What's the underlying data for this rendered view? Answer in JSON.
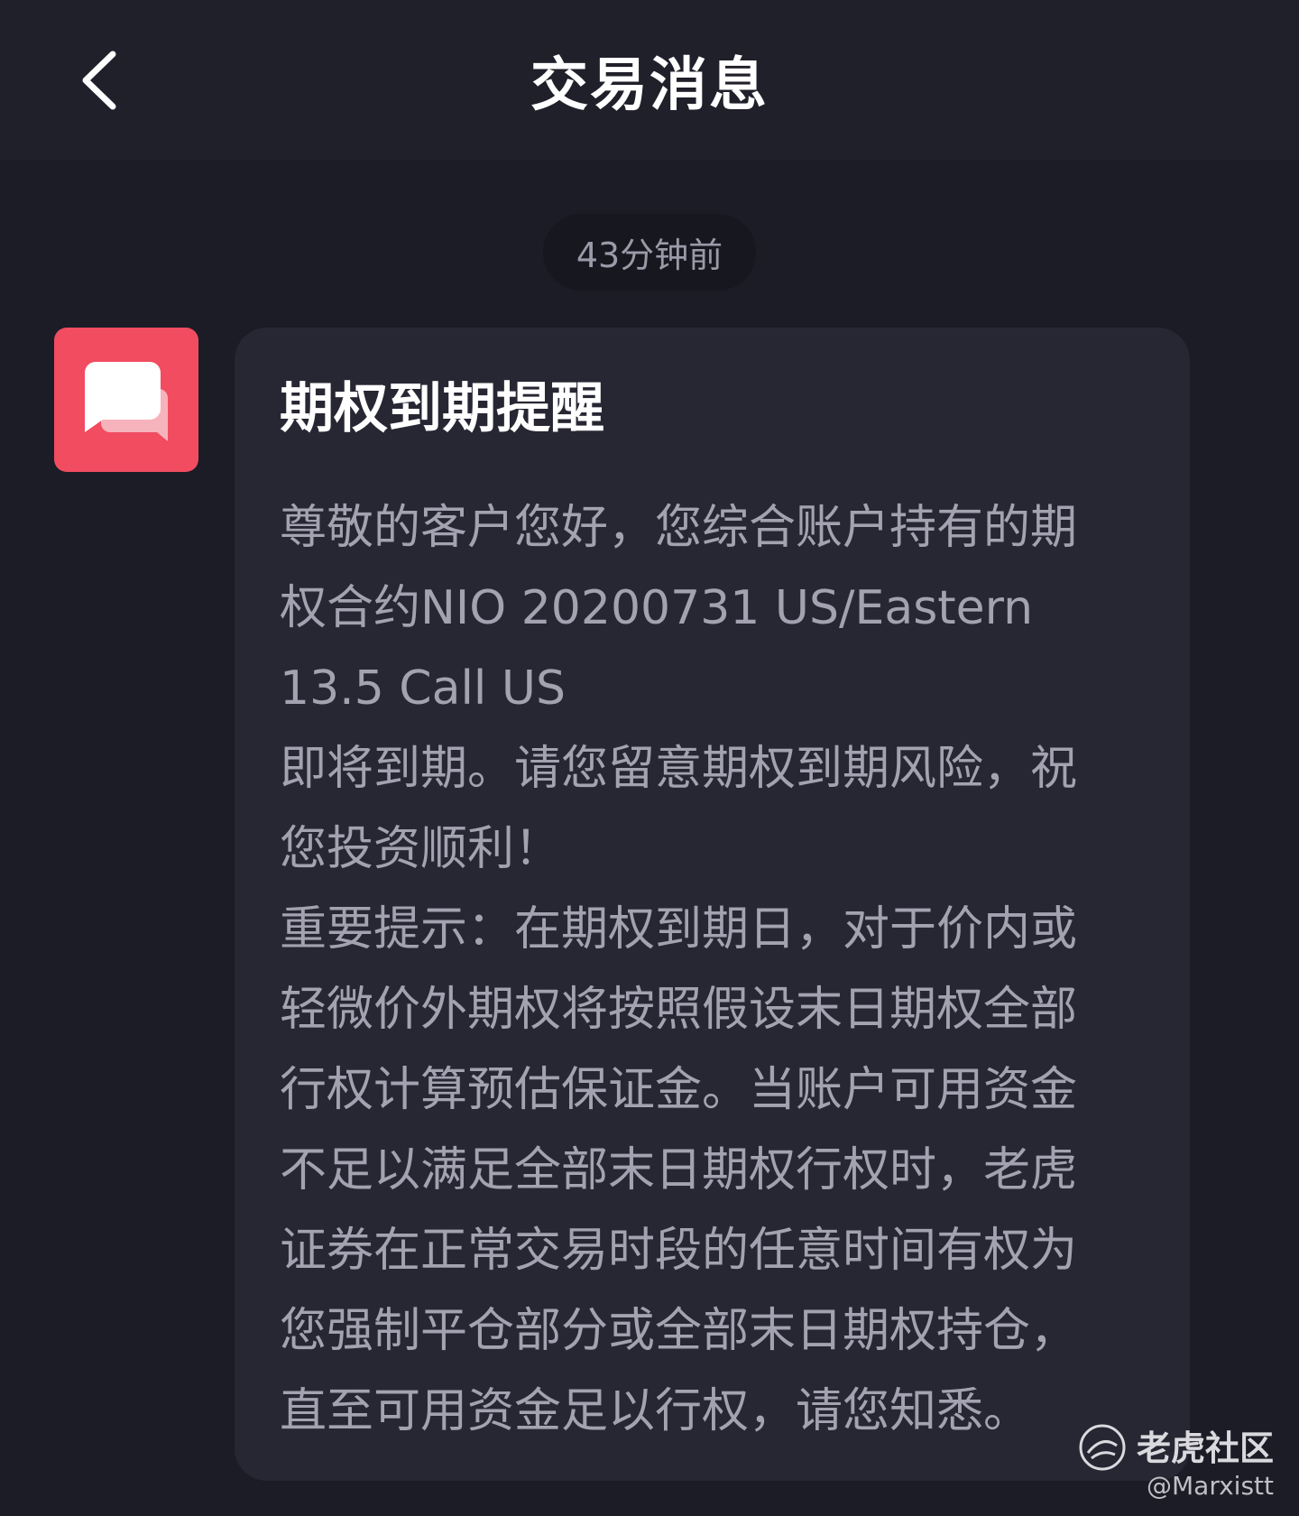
{
  "header": {
    "title": "交易消息",
    "back_icon": "chevron-left-icon"
  },
  "timestamp": "43分钟前",
  "message": {
    "avatar_icon": "chat-bubbles-icon",
    "avatar_color": "#f14c60",
    "title": "期权到期提醒",
    "paragraphs": [
      "尊敬的客户您好，您综合账户持有的期权合约NIO 20200731 US/Eastern 13.5 Call US",
      "即将到期。请您留意期权到期风险，祝您投资顺利！",
      "重要提示：在期权到期日，对于价内或轻微价外期权将按照假设末日期权全部行权计算预估保证金。当账户可用资金不足以满足全部末日期权行权时，老虎证券在正常交易时段的任意时间有权为您强制平仓部分或全部末日期权持仓，直至可用资金足以行权，请您知悉。"
    ]
  },
  "watermark": {
    "name": "老虎社区",
    "handle": "@Marxistt",
    "logo_icon": "tiger-logo-icon"
  },
  "colors": {
    "background": "#1c1c27",
    "header": "#20202b",
    "card": "#272734",
    "accent": "#f14c60"
  }
}
